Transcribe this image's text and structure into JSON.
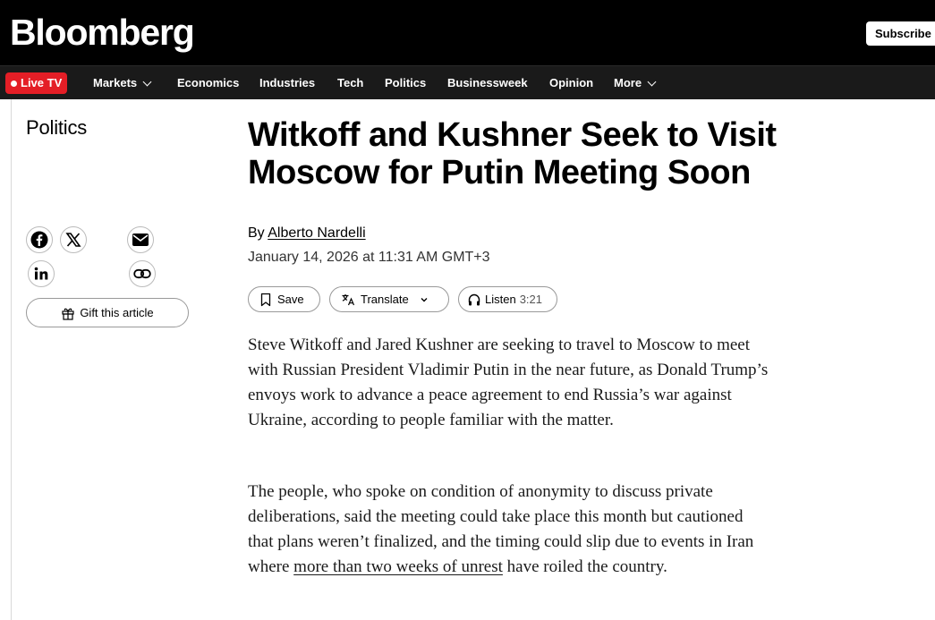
{
  "header": {
    "logo": "Bloomberg",
    "subscribe_label": "Subscribe"
  },
  "nav": {
    "live_tv_label": "Live TV",
    "items": [
      {
        "label": "Markets",
        "has_dropdown": true
      },
      {
        "label": "Economics",
        "has_dropdown": false
      },
      {
        "label": "Industries",
        "has_dropdown": false
      },
      {
        "label": "Tech",
        "has_dropdown": false
      },
      {
        "label": "Politics",
        "has_dropdown": false
      },
      {
        "label": "Businessweek",
        "has_dropdown": false
      },
      {
        "label": "Opinion",
        "has_dropdown": false
      },
      {
        "label": "More",
        "has_dropdown": true
      }
    ]
  },
  "sidebar": {
    "section": "Politics",
    "share_icons": [
      "facebook-icon",
      "x-icon",
      "email-icon",
      "linkedin-icon",
      "link-icon"
    ],
    "gift_label": "Gift this article"
  },
  "article": {
    "headline": "Witkoff and Kushner Seek to Visit Moscow for Putin Meeting Soon",
    "by_prefix": "By",
    "author": "Alberto Nardelli",
    "date": "January 14, 2026 at 11:31 AM GMT+3",
    "actions": {
      "save_label": "Save",
      "translate_label": "Translate",
      "listen_label": "Listen",
      "listen_duration": "3:21"
    },
    "paragraph1": "Steve Witkoff and Jared Kushner are seeking to travel to Moscow to meet with Russian President Vladimir Putin in the near future, as Donald Trump’s envoys work to advance a peace agreement to end Russia’s war against Ukraine, according to people familiar with the matter.",
    "paragraph2_before": "The people, who spoke on condition of anonymity to discuss private deliberations, said the meeting could take place this month but cautioned that plans weren’t finalized, and the timing could slip due to events in Iran where ",
    "paragraph2_link": "more than two weeks of unrest",
    "paragraph2_after": " have roiled the country."
  },
  "colors": {
    "header_bg": "#000000",
    "nav_bg": "#1a1a1a",
    "live_tv_red": "#e41e26"
  }
}
